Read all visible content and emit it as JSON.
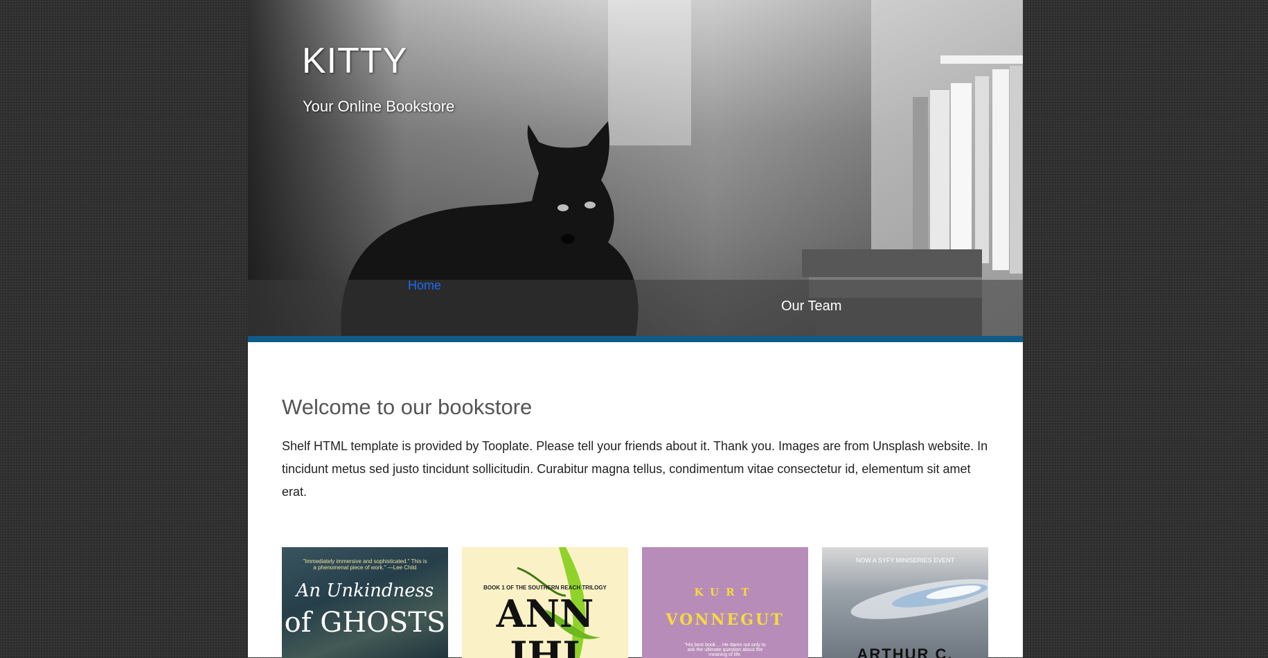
{
  "site": {
    "title": "KITTY",
    "tagline": "Your Online Bookstore"
  },
  "nav": {
    "items": [
      {
        "label": "Home"
      },
      {
        "label": "Our Team"
      }
    ],
    "active_color": "#1a6cf2"
  },
  "main": {
    "heading": "Welcome to our bookstore",
    "intro": "Shelf HTML template is provided by Tooplate. Please tell your friends about it. Thank you. Images are from Unsplash website. In tincidunt metus sed justo tincidunt sollicitudin. Curabitur magna tellus, condimentum vitae consectetur id, elementum sit amet erat."
  },
  "books": [
    {
      "cover_blurb": "\"Immediately immersive and sophisticated.\" This is a phenomenal piece of work.\" —Lee Child",
      "cover_title_1": "An Unkindness",
      "cover_title_2": "of GHOSTS"
    },
    {
      "cover_blurb": "BOOK 1 OF THE SOUTHERN REACH TRILOGY",
      "cover_title_1": "ANN",
      "cover_title_2": "IHI"
    },
    {
      "cover_author_1": "KURT",
      "cover_author_2": "VONNEGUT",
      "cover_blurb": "\"His best book ... He dares not only to ask the ultimate question about the meaning of life."
    },
    {
      "cover_blurb": "NOW A SYFY MINISERIES EVENT",
      "cover_title_1": "ARTHUR C. CLARKE"
    }
  ],
  "colors": {
    "accent_bar": "#0f5a86",
    "page_background": "#2e2e2e"
  }
}
